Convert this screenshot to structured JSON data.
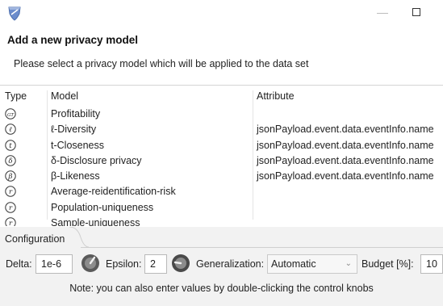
{
  "window": {
    "app_icon": "shield-icon",
    "minimize_glyph": "—",
    "maximize_icon": "square-icon"
  },
  "header": {
    "title": "Add a new privacy model",
    "description": "Please select a privacy model which will be applied to the data set"
  },
  "table": {
    "columns": [
      "Type",
      "Model",
      "Attribute"
    ],
    "rows": [
      {
        "icon": "GT",
        "model": "Profitability",
        "attribute": ""
      },
      {
        "icon": "ℓ",
        "model": "ℓ-Diversity",
        "attribute": "jsonPayload.event.data.eventInfo.name"
      },
      {
        "icon": "t",
        "model": "t-Closeness",
        "attribute": "jsonPayload.event.data.eventInfo.name"
      },
      {
        "icon": "δ",
        "model": "δ-Disclosure privacy",
        "attribute": "jsonPayload.event.data.eventInfo.name"
      },
      {
        "icon": "β",
        "model": "β-Likeness",
        "attribute": "jsonPayload.event.data.eventInfo.name"
      },
      {
        "icon": "r",
        "model": "Average-reidentification-risk",
        "attribute": ""
      },
      {
        "icon": "r",
        "model": "Population-uniqueness",
        "attribute": ""
      },
      {
        "icon": "r",
        "model": "Sample-uniqueness",
        "attribute": ""
      }
    ]
  },
  "config": {
    "tab_label": "Configuration",
    "delta_label": "Delta:",
    "delta_value": "1e-6",
    "epsilon_label": "Epsilon:",
    "epsilon_value": "2",
    "generalization_label": "Generalization:",
    "generalization_value": "Automatic",
    "budget_label": "Budget [%]:",
    "budget_value": "10",
    "note": "Note: you can also enter values by double-clicking the control knobs"
  },
  "colors": {
    "config_bg": "#f2f2f2",
    "shield_blue": "#5a7dbd",
    "knob_dark": "#4a4a4a"
  }
}
